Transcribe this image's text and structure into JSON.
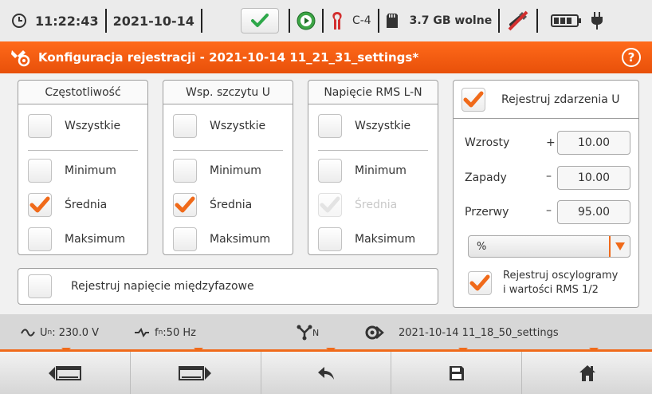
{
  "status": {
    "time": "11:22:43",
    "date": "2021-10-14",
    "channel": "C-4",
    "storage": "3.7 GB wolne"
  },
  "title": {
    "text": "Konfiguracja rejestracji - 2021-10-14 11_21_31_settings*",
    "help": "?"
  },
  "groups": [
    {
      "header": "Częstotliwość",
      "all_label": "Wszystkie",
      "items": [
        {
          "label": "Minimum",
          "checked": false,
          "disabled": false
        },
        {
          "label": "Średnia",
          "checked": true,
          "disabled": false
        },
        {
          "label": "Maksimum",
          "checked": false,
          "disabled": false
        }
      ]
    },
    {
      "header": "Wsp. szczytu U",
      "all_label": "Wszystkie",
      "items": [
        {
          "label": "Minimum",
          "checked": false,
          "disabled": false
        },
        {
          "label": "Średnia",
          "checked": true,
          "disabled": false
        },
        {
          "label": "Maksimum",
          "checked": false,
          "disabled": false
        }
      ]
    },
    {
      "header": "Napięcie RMS L-N",
      "all_label": "Wszystkie",
      "items": [
        {
          "label": "Minimum",
          "checked": false,
          "disabled": false
        },
        {
          "label": "Średnia",
          "checked": true,
          "disabled": true
        },
        {
          "label": "Maksimum",
          "checked": false,
          "disabled": false
        }
      ]
    }
  ],
  "interphase": {
    "label": "Rejestruj napięcie międzyfazowe",
    "checked": false
  },
  "events": {
    "header": "Rejestruj zdarzenia U",
    "checked": true,
    "swells_label": "Wzrosty",
    "swells_sign": "+",
    "swells_value": "10.00",
    "dips_label": "Zapady",
    "dips_sign": "–",
    "dips_value": "10.00",
    "interruptions_label": "Przerwy",
    "interruptions_sign": "–",
    "interruptions_value": "95.00",
    "unit": "%",
    "osc_line1": "Rejestruj oscylogramy",
    "osc_line2": "i wartości RMS 1/2",
    "osc_checked": true
  },
  "info": {
    "voltage_prefix": "U",
    "voltage_sub": "n",
    "voltage_value": ": 230.0 V",
    "freq_prefix": "f",
    "freq_sub": "n",
    "freq_value": ":50 Hz",
    "network_sub": "N",
    "settings_file": "2021-10-14 11_18_50_settings"
  },
  "colors": {
    "accent": "#f06a1a",
    "check": "#f06a1a",
    "green": "#28a745"
  }
}
